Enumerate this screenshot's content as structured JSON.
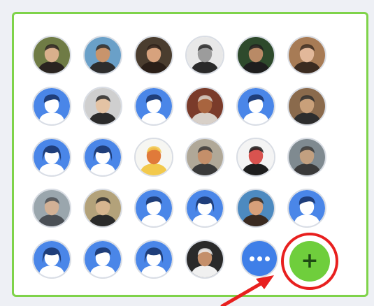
{
  "panel": {
    "border_color": "#7fd34a"
  },
  "avatars": [
    {
      "type": "photo",
      "palette": [
        "#6f7b45",
        "#2a2420",
        "#d9b08c"
      ]
    },
    {
      "type": "photo",
      "palette": [
        "#6aa0c8",
        "#2d2d2d",
        "#c8946c"
      ]
    },
    {
      "type": "photo",
      "palette": [
        "#4a3d2f",
        "#2a1f18",
        "#d7a27d"
      ]
    },
    {
      "type": "photo",
      "palette": [
        "#e8e8e8",
        "#2a2a2a",
        "#9c9c9c"
      ]
    },
    {
      "type": "photo",
      "palette": [
        "#2e4a2c",
        "#1e1e1e",
        "#b98a66"
      ]
    },
    {
      "type": "photo",
      "palette": [
        "#a77b55",
        "#3b2b20",
        "#e2b89a"
      ]
    },
    {
      "type": "generic-male"
    },
    {
      "type": "photo",
      "palette": [
        "#cfcfcf",
        "#2b2b2b",
        "#e4c3a4"
      ]
    },
    {
      "type": "generic-male"
    },
    {
      "type": "photo",
      "palette": [
        "#7a3b2a",
        "#d8d0c8",
        "#a8643f"
      ]
    },
    {
      "type": "generic-male"
    },
    {
      "type": "photo",
      "palette": [
        "#8a6a4c",
        "#2d2d2d",
        "#c9a07a"
      ]
    },
    {
      "type": "generic-female"
    },
    {
      "type": "generic-female"
    },
    {
      "type": "photo",
      "palette": [
        "#f6f6f2",
        "#f2c94c",
        "#e07a3a"
      ]
    },
    {
      "type": "photo",
      "palette": [
        "#b0a898",
        "#3a3a3a",
        "#c48f6a"
      ]
    },
    {
      "type": "photo",
      "palette": [
        "#f4f4f4",
        "#1e1e1e",
        "#d9534f"
      ]
    },
    {
      "type": "photo",
      "palette": [
        "#7f8a90",
        "#3a3a3a",
        "#c2a080"
      ]
    },
    {
      "type": "photo",
      "palette": [
        "#9aa6ad",
        "#4a4f55",
        "#d2b196"
      ]
    },
    {
      "type": "photo",
      "palette": [
        "#b3a27a",
        "#2a2a2a",
        "#d6b58f"
      ]
    },
    {
      "type": "generic-male"
    },
    {
      "type": "generic-female"
    },
    {
      "type": "photo",
      "palette": [
        "#4d8ac0",
        "#3a2a20",
        "#d7a07a"
      ]
    },
    {
      "type": "generic-male"
    },
    {
      "type": "generic-female"
    },
    {
      "type": "generic-male"
    },
    {
      "type": "generic-female"
    },
    {
      "type": "photo",
      "palette": [
        "#2a2a2a",
        "#f0f0f0",
        "#c48f6a"
      ]
    }
  ],
  "more_button": {
    "label": "•••"
  },
  "add_button": {
    "label": "+"
  },
  "colors": {
    "generic_bg": "#4a86e8",
    "generic_figure": "#ffffff",
    "generic_hair": "#1f3e7a",
    "highlight_ring": "#e8201f",
    "add_green": "#6fce3c",
    "more_blue": "#3f7fe8"
  }
}
